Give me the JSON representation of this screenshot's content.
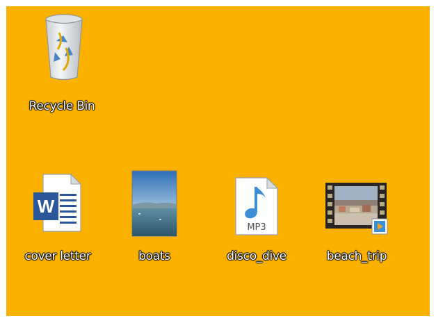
{
  "desktop": {
    "background_color": "#fbb100",
    "icons": [
      {
        "label": "Recycle Bin",
        "icon": "recycle-bin-icon"
      },
      {
        "label": "cover letter",
        "icon": "word-document-icon"
      },
      {
        "label": "boats",
        "icon": "image-file-icon"
      },
      {
        "label": "disco_dive",
        "icon": "mp3-file-icon"
      },
      {
        "label": "beach_trip",
        "icon": "video-file-icon"
      }
    ]
  }
}
